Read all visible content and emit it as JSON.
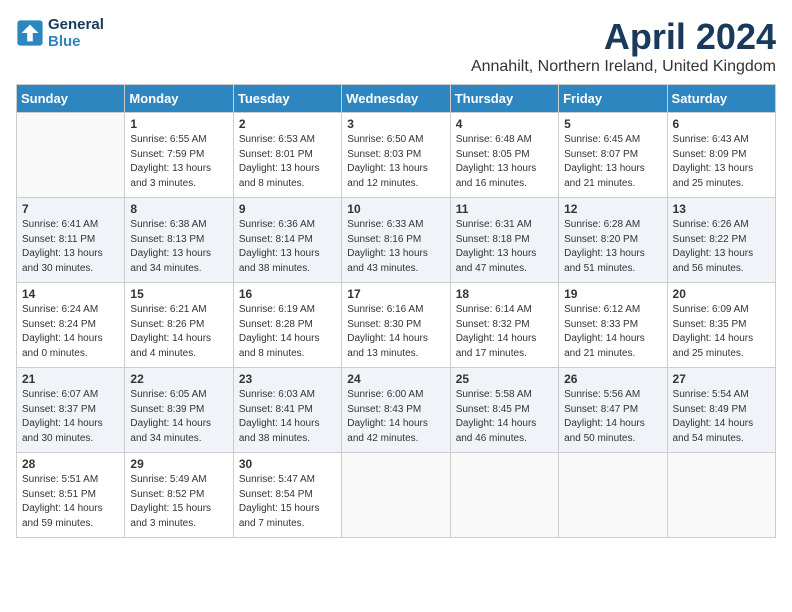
{
  "header": {
    "logo_line1": "General",
    "logo_line2": "Blue",
    "month_title": "April 2024",
    "location": "Annahilt, Northern Ireland, United Kingdom"
  },
  "weekdays": [
    "Sunday",
    "Monday",
    "Tuesday",
    "Wednesday",
    "Thursday",
    "Friday",
    "Saturday"
  ],
  "weeks": [
    [
      {
        "day": "",
        "sunrise": "",
        "sunset": "",
        "daylight": ""
      },
      {
        "day": "1",
        "sunrise": "6:55 AM",
        "sunset": "7:59 PM",
        "daylight": "13 hours and 3 minutes."
      },
      {
        "day": "2",
        "sunrise": "6:53 AM",
        "sunset": "8:01 PM",
        "daylight": "13 hours and 8 minutes."
      },
      {
        "day": "3",
        "sunrise": "6:50 AM",
        "sunset": "8:03 PM",
        "daylight": "13 hours and 12 minutes."
      },
      {
        "day": "4",
        "sunrise": "6:48 AM",
        "sunset": "8:05 PM",
        "daylight": "13 hours and 16 minutes."
      },
      {
        "day": "5",
        "sunrise": "6:45 AM",
        "sunset": "8:07 PM",
        "daylight": "13 hours and 21 minutes."
      },
      {
        "day": "6",
        "sunrise": "6:43 AM",
        "sunset": "8:09 PM",
        "daylight": "13 hours and 25 minutes."
      }
    ],
    [
      {
        "day": "7",
        "sunrise": "6:41 AM",
        "sunset": "8:11 PM",
        "daylight": "13 hours and 30 minutes."
      },
      {
        "day": "8",
        "sunrise": "6:38 AM",
        "sunset": "8:13 PM",
        "daylight": "13 hours and 34 minutes."
      },
      {
        "day": "9",
        "sunrise": "6:36 AM",
        "sunset": "8:14 PM",
        "daylight": "13 hours and 38 minutes."
      },
      {
        "day": "10",
        "sunrise": "6:33 AM",
        "sunset": "8:16 PM",
        "daylight": "13 hours and 43 minutes."
      },
      {
        "day": "11",
        "sunrise": "6:31 AM",
        "sunset": "8:18 PM",
        "daylight": "13 hours and 47 minutes."
      },
      {
        "day": "12",
        "sunrise": "6:28 AM",
        "sunset": "8:20 PM",
        "daylight": "13 hours and 51 minutes."
      },
      {
        "day": "13",
        "sunrise": "6:26 AM",
        "sunset": "8:22 PM",
        "daylight": "13 hours and 56 minutes."
      }
    ],
    [
      {
        "day": "14",
        "sunrise": "6:24 AM",
        "sunset": "8:24 PM",
        "daylight": "14 hours and 0 minutes."
      },
      {
        "day": "15",
        "sunrise": "6:21 AM",
        "sunset": "8:26 PM",
        "daylight": "14 hours and 4 minutes."
      },
      {
        "day": "16",
        "sunrise": "6:19 AM",
        "sunset": "8:28 PM",
        "daylight": "14 hours and 8 minutes."
      },
      {
        "day": "17",
        "sunrise": "6:16 AM",
        "sunset": "8:30 PM",
        "daylight": "14 hours and 13 minutes."
      },
      {
        "day": "18",
        "sunrise": "6:14 AM",
        "sunset": "8:32 PM",
        "daylight": "14 hours and 17 minutes."
      },
      {
        "day": "19",
        "sunrise": "6:12 AM",
        "sunset": "8:33 PM",
        "daylight": "14 hours and 21 minutes."
      },
      {
        "day": "20",
        "sunrise": "6:09 AM",
        "sunset": "8:35 PM",
        "daylight": "14 hours and 25 minutes."
      }
    ],
    [
      {
        "day": "21",
        "sunrise": "6:07 AM",
        "sunset": "8:37 PM",
        "daylight": "14 hours and 30 minutes."
      },
      {
        "day": "22",
        "sunrise": "6:05 AM",
        "sunset": "8:39 PM",
        "daylight": "14 hours and 34 minutes."
      },
      {
        "day": "23",
        "sunrise": "6:03 AM",
        "sunset": "8:41 PM",
        "daylight": "14 hours and 38 minutes."
      },
      {
        "day": "24",
        "sunrise": "6:00 AM",
        "sunset": "8:43 PM",
        "daylight": "14 hours and 42 minutes."
      },
      {
        "day": "25",
        "sunrise": "5:58 AM",
        "sunset": "8:45 PM",
        "daylight": "14 hours and 46 minutes."
      },
      {
        "day": "26",
        "sunrise": "5:56 AM",
        "sunset": "8:47 PM",
        "daylight": "14 hours and 50 minutes."
      },
      {
        "day": "27",
        "sunrise": "5:54 AM",
        "sunset": "8:49 PM",
        "daylight": "14 hours and 54 minutes."
      }
    ],
    [
      {
        "day": "28",
        "sunrise": "5:51 AM",
        "sunset": "8:51 PM",
        "daylight": "14 hours and 59 minutes."
      },
      {
        "day": "29",
        "sunrise": "5:49 AM",
        "sunset": "8:52 PM",
        "daylight": "15 hours and 3 minutes."
      },
      {
        "day": "30",
        "sunrise": "5:47 AM",
        "sunset": "8:54 PM",
        "daylight": "15 hours and 7 minutes."
      },
      {
        "day": "",
        "sunrise": "",
        "sunset": "",
        "daylight": ""
      },
      {
        "day": "",
        "sunrise": "",
        "sunset": "",
        "daylight": ""
      },
      {
        "day": "",
        "sunrise": "",
        "sunset": "",
        "daylight": ""
      },
      {
        "day": "",
        "sunrise": "",
        "sunset": "",
        "daylight": ""
      }
    ]
  ]
}
